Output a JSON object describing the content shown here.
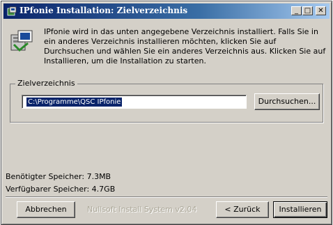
{
  "window": {
    "title": "IPfonie Installation: Zielverzeichnis",
    "min_glyph": "_",
    "max_glyph": "□",
    "close_glyph": "✕"
  },
  "info": {
    "text": "IPfonie wird in das unten angegebene Verzeichnis installiert. Falls Sie in ein anderes Verzeichnis installieren möchten, klicken Sie auf Durchsuchen und wählen Sie ein anderes Verzeichnis aus. Klicken Sie auf Installieren, um die Installation zu starten."
  },
  "target": {
    "group_label": "Zielverzeichnis",
    "path_value": "C:\\Programme\\QSC IPfonie",
    "browse_label": "Durchsuchen..."
  },
  "space": {
    "required": "Benötigter Speicher: 7.3MB",
    "available": "Verfügbarer Speicher: 4.7GB"
  },
  "footer": {
    "cancel_label": "Abbrechen",
    "brand": "Nullsoft Install System v2.04",
    "back_label": "< Zurück",
    "install_label": "Installieren"
  }
}
